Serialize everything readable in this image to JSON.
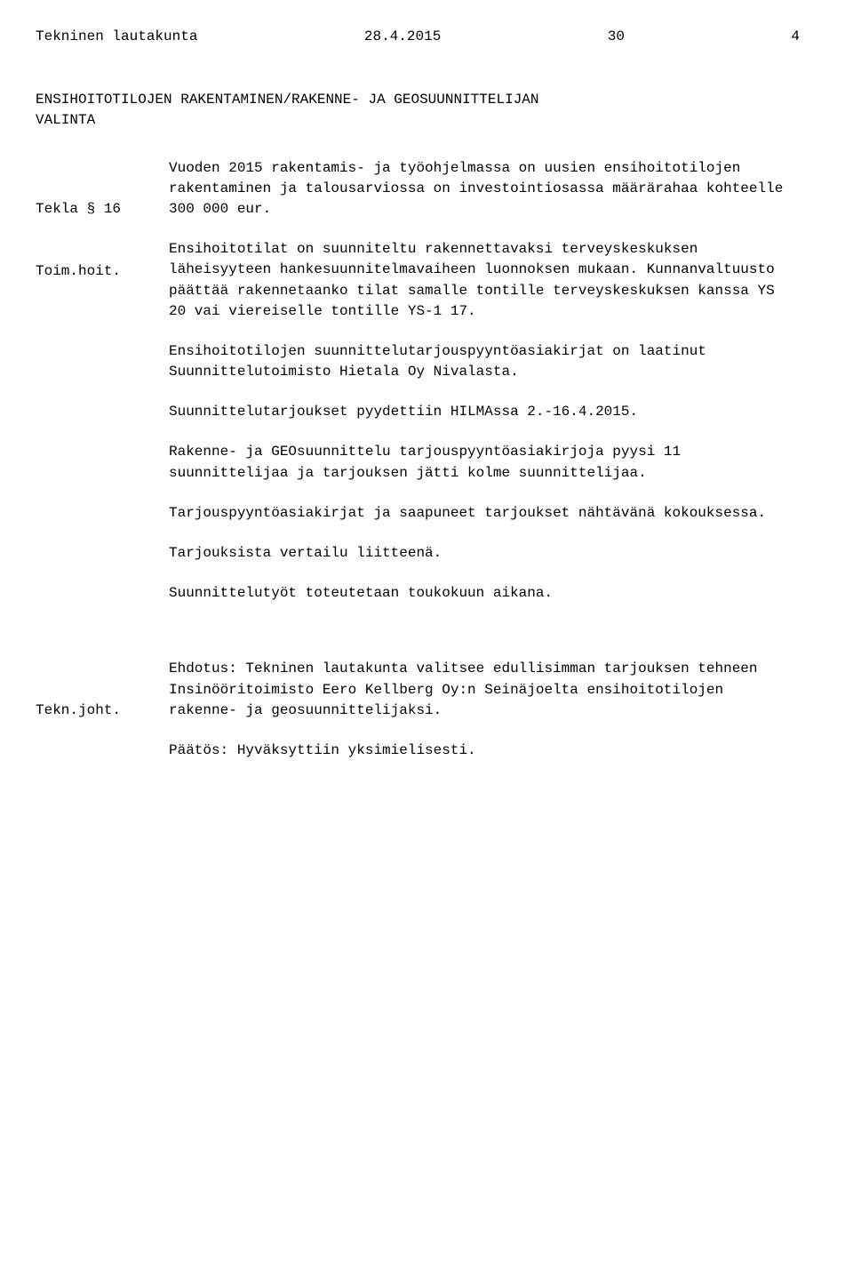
{
  "header": {
    "committee": "Tekninen lautakunta",
    "date": "28.4.2015",
    "page_num": "30",
    "section_num": "4"
  },
  "title": {
    "line1": "ENSIHOITOTILOJEN RAKENTAMINEN/RAKENNE- JA GEOSUUNNITTELIJAN",
    "line2": "VALINTA"
  },
  "labels": {
    "tekla": "Tekla § 16",
    "toimhoit": "Toim.hoit.",
    "teknjoht": "Tekn.joht."
  },
  "body": {
    "p1": "Vuoden 2015 rakentamis- ja työohjelmassa on uusien ensihoitotilojen rakentaminen ja talousarviossa on investointiosassa määrärahaa kohteelle 300 000 eur.",
    "p2": "Ensihoitotilat on suunniteltu rakennettavaksi terveyskeskuksen läheisyyteen hankesuunnitelmavaiheen luonnoksen mukaan. Kunnanvaltuusto päättää rakennetaanko tilat samalle tontille terveyskeskuksen kanssa YS 20 vai viereiselle tontille YS-1 17.",
    "p3": "Ensihoitotilojen suunnittelutarjouspyyntöasiakirjat on laatinut Suunnittelutoimisto Hietala Oy Nivalasta.",
    "p4": "Suunnittelutarjoukset pyydettiin HILMAssa 2.-16.4.2015.",
    "p5": "Rakenne- ja GEOsuunnittelu tarjouspyyntöasiakirjoja pyysi 11 suunnittelijaa ja tarjouksen jätti kolme suunnittelijaa.",
    "p6": "Tarjouspyyntöasiakirjat ja saapuneet tarjoukset nähtävänä kokouksessa.",
    "p7": "Tarjouksista vertailu liitteenä.",
    "p8": "Suunnittelutyöt toteutetaan toukokuun aikana."
  },
  "proposal": {
    "p1": "Ehdotus: Tekninen lautakunta valitsee edullisimman tarjouksen tehneen Insinööritoimisto Eero Kellberg Oy:n Seinäjoelta ensihoitotilojen rakenne- ja geosuunnittelijaksi.",
    "p2": "Päätös: Hyväksyttiin yksimielisesti."
  }
}
